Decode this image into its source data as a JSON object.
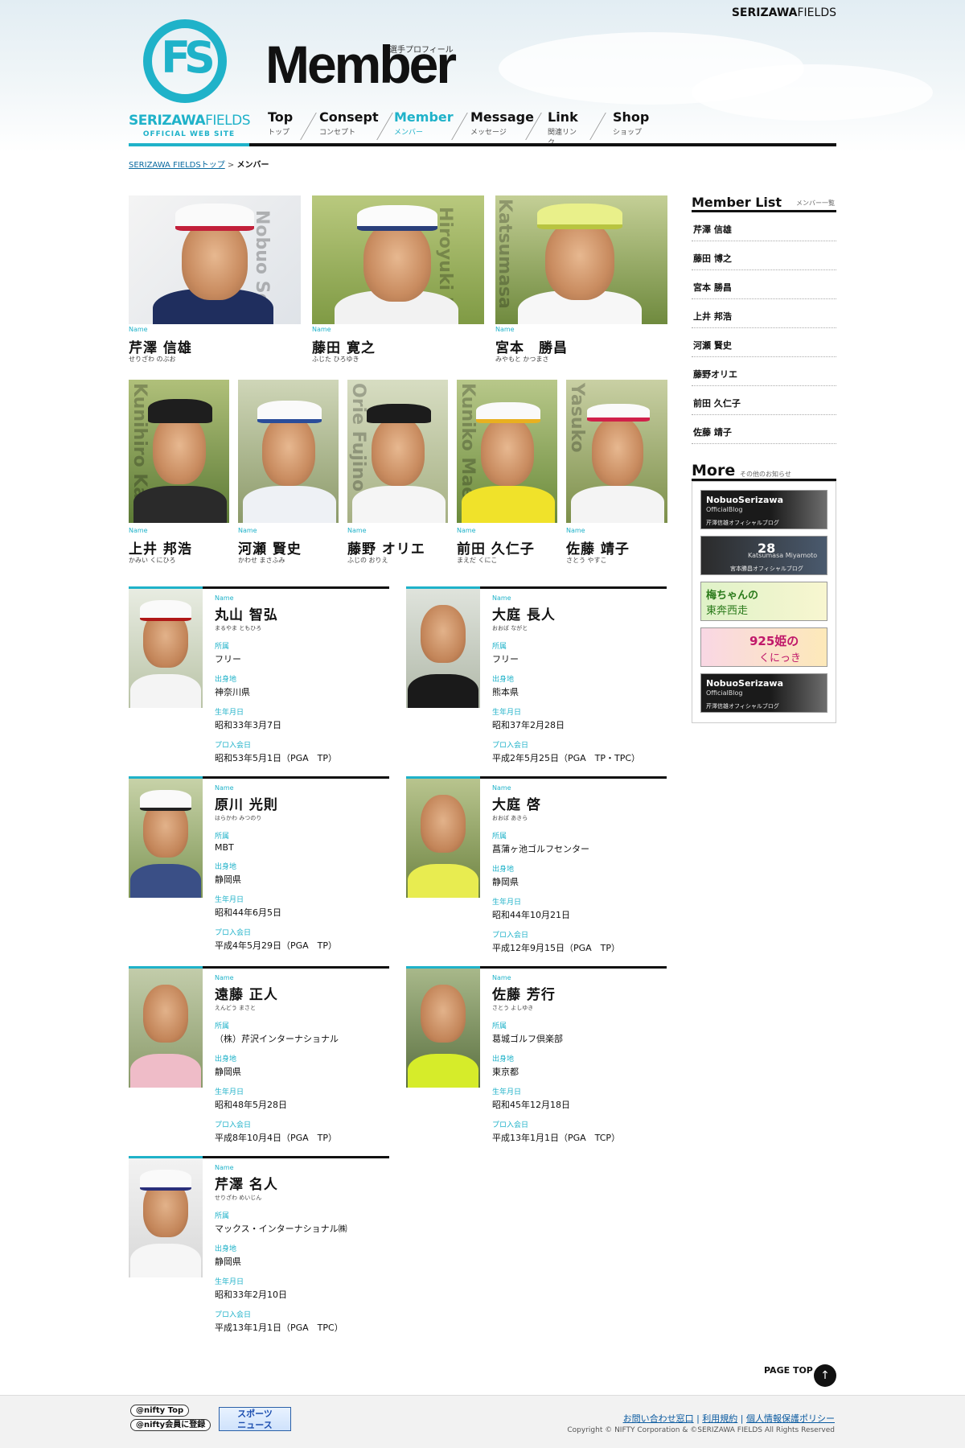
{
  "brand_top": {
    "bold": "SERIZAWA",
    "rest": "FIELDS"
  },
  "logo": {
    "letters": "FS",
    "name_bold": "SERIZAWA",
    "name_rest": "FIELDS",
    "sub": "OFFICIAL WEB SITE"
  },
  "page_title": "Member",
  "page_title_sub": "選手プロフィール",
  "nav": [
    {
      "en": "Top",
      "jp": "トップ"
    },
    {
      "en": "Consept",
      "jp": "コンセプト"
    },
    {
      "en": "Member",
      "jp": "メンバー"
    },
    {
      "en": "Message",
      "jp": "メッセージ"
    },
    {
      "en": "Link",
      "jp": "関連リンク"
    },
    {
      "en": "Shop",
      "jp": "ショップ"
    }
  ],
  "breadcrumb": {
    "home": "SERIZAWA FIELDSトップ",
    "sep": ">",
    "current": "メンバー"
  },
  "name_label": "Name",
  "featured_row1": [
    {
      "name": "芹澤 信雄",
      "kana": "せりざわ のぶお",
      "vertical": "Nobuo Serizawa"
    },
    {
      "name": "藤田 寛之",
      "kana": "ふじた ひろゆき",
      "vertical": "Hiroyuki Fujita"
    },
    {
      "name": "宮本　勝昌",
      "kana": "みやもと かつまさ",
      "vertical": "Katsumasa"
    }
  ],
  "featured_row2": [
    {
      "name": "上井 邦浩",
      "kana": "かみい くにひろ",
      "vertical": "Kunihiro Kamii"
    },
    {
      "name": "河瀬 賢史",
      "kana": "かわせ まさふみ",
      "vertical": ""
    },
    {
      "name": "藤野 オリエ",
      "kana": "ふじの おりえ",
      "vertical": "Orie Fujino"
    },
    {
      "name": "前田 久仁子",
      "kana": "まえだ くにこ",
      "vertical": "Kuniko Maeda"
    },
    {
      "name": "佐藤 靖子",
      "kana": "さとう やすこ",
      "vertical": "Yasuko"
    }
  ],
  "field_labels": {
    "affiliation": "所属",
    "birthplace": "出身地",
    "birthday": "生年月日",
    "pro": "プロ入会日"
  },
  "profiles": [
    {
      "name": "丸山 智弘",
      "kana": "まるやま ともひろ",
      "affiliation": "フリー",
      "birthplace": "神奈川県",
      "birthday": "昭和33年3月7日",
      "pro": "昭和53年5月1日（PGA　TP）"
    },
    {
      "name": "大庭 長人",
      "kana": "おおば ながと",
      "affiliation": "フリー",
      "birthplace": "熊本県",
      "birthday": "昭和37年2月28日",
      "pro": "平成2年5月25日（PGA　TP・TPC）"
    },
    {
      "name": "原川 光則",
      "kana": "はらかわ みつのり",
      "affiliation": "MBT",
      "birthplace": "静岡県",
      "birthday": "昭和44年6月5日",
      "pro": "平成4年5月29日（PGA　TP）"
    },
    {
      "name": "大庭 啓",
      "kana": "おおば あきら",
      "affiliation": "菖蒲ヶ池ゴルフセンター",
      "birthplace": "静岡県",
      "birthday": "昭和44年10月21日",
      "pro": "平成12年9月15日（PGA　TP）"
    },
    {
      "name": "遠藤 正人",
      "kana": "えんどう まさと",
      "affiliation": "（株）芹沢インターナショナル",
      "birthplace": "静岡県",
      "birthday": "昭和48年5月28日",
      "pro": "平成8年10月4日（PGA　TP）"
    },
    {
      "name": "佐藤 芳行",
      "kana": "さとう よしゆき",
      "affiliation": "葛城ゴルフ倶楽部",
      "birthplace": "東京都",
      "birthday": "昭和45年12月18日",
      "pro": "平成13年1月1日（PGA　TCP）"
    },
    {
      "name": "芹澤 名人",
      "kana": "せりざわ めいじん",
      "affiliation": "マックス・インターナショナル㈱",
      "birthplace": "静岡県",
      "birthday": "昭和33年2月10日",
      "pro": "平成13年1月1日（PGA　TPC）"
    }
  ],
  "sidebar": {
    "member_list_title": "Member List",
    "member_list_sub": "メンバー一覧",
    "members": [
      "芹澤 信雄",
      "藤田 博之",
      "宮本 勝昌",
      "上井 邦浩",
      "河瀬 賢史",
      "藤野オリエ",
      "前田 久仁子",
      "佐藤 靖子"
    ],
    "more_title": "More",
    "more_sub": "その他のお知らせ",
    "banners": [
      {
        "t1": "NobuoSerizawa",
        "t2": "OfficialBlog",
        "t3": "芹澤信雄オフィシャルブログ"
      },
      {
        "t1": "28",
        "t2": "Katsumasa Miyamoto",
        "t3": "宮本勝昌オフィシャルブログ"
      },
      {
        "t1": "梅ちゃんの",
        "t2": "東奔西走",
        "t3": ""
      },
      {
        "t1": "925姫の",
        "t2": "くにっき",
        "t3": ""
      },
      {
        "t1": "NobuoSerizawa",
        "t2": "OfficialBlog",
        "t3": "芹澤信雄オフィシャルブログ"
      }
    ]
  },
  "page_top": "PAGE TOP",
  "footer": {
    "nifty_top": "@nifty Top",
    "nifty_join": "@nifty会員に登録",
    "sports_l1": "スポーツ",
    "sports_l2": "ニュース",
    "link_contact": "お問い合わせ窓口",
    "link_terms": "利用規約",
    "link_privacy": "個人情報保護ポリシー",
    "copyright": "Copyright © NIFTY Corporation & ©SERIZAWA FIELDS  All Rights Reserved"
  }
}
